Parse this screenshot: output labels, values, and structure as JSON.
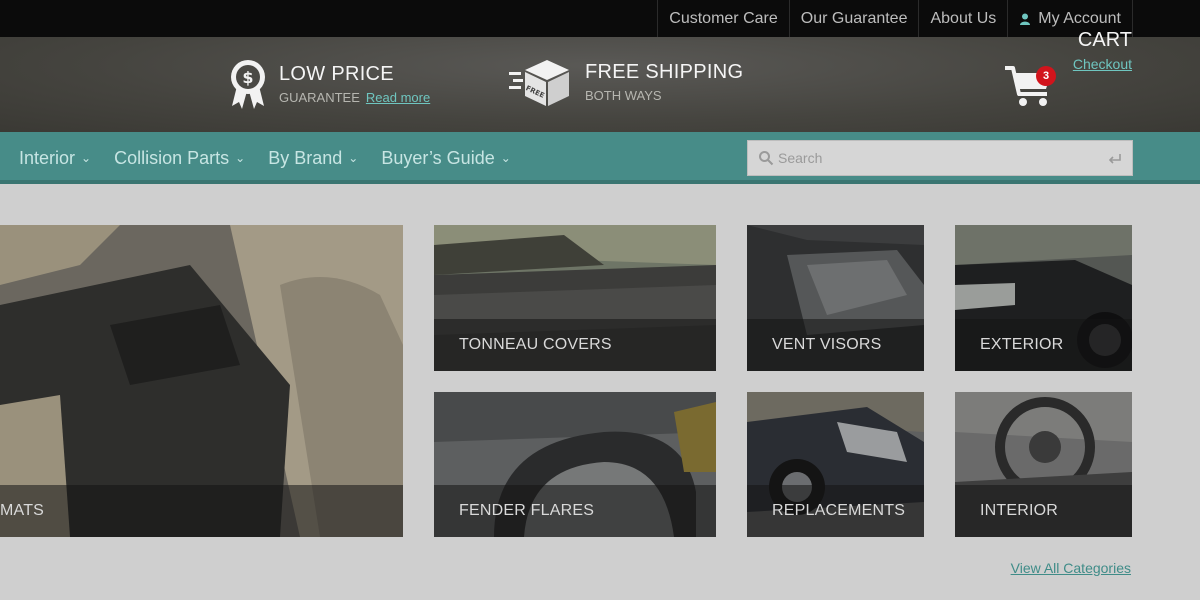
{
  "topbar": {
    "links": [
      "Customer Care",
      "Our Guarantee",
      "About Us"
    ],
    "account": "My Account"
  },
  "header": {
    "low_price": {
      "title": "LOW PRICE",
      "sub": "GUARANTEE",
      "link": "Read more"
    },
    "free_shipping": {
      "title": "FREE SHIPPING",
      "sub": "BOTH WAYS",
      "box_text": "FREE"
    },
    "cart": {
      "title": "CART",
      "link": "Checkout",
      "count": "3"
    }
  },
  "nav": {
    "items": [
      "Interior",
      "Collision Parts",
      "By Brand",
      "Buyer’s Guide"
    ],
    "search_placeholder": "Search"
  },
  "tiles": {
    "mats": "MATS",
    "tonneau": "TONNEAU COVERS",
    "vent": "VENT VISORS",
    "exterior": "EXTERIOR",
    "fender": "FENDER FLARES",
    "replacements": "REPLACEMENTS",
    "interior": "INTERIOR"
  },
  "view_all": "View All Categories",
  "colors": {
    "accent": "#478c88",
    "badge": "#d2141c",
    "link": "#6fc6c0"
  }
}
